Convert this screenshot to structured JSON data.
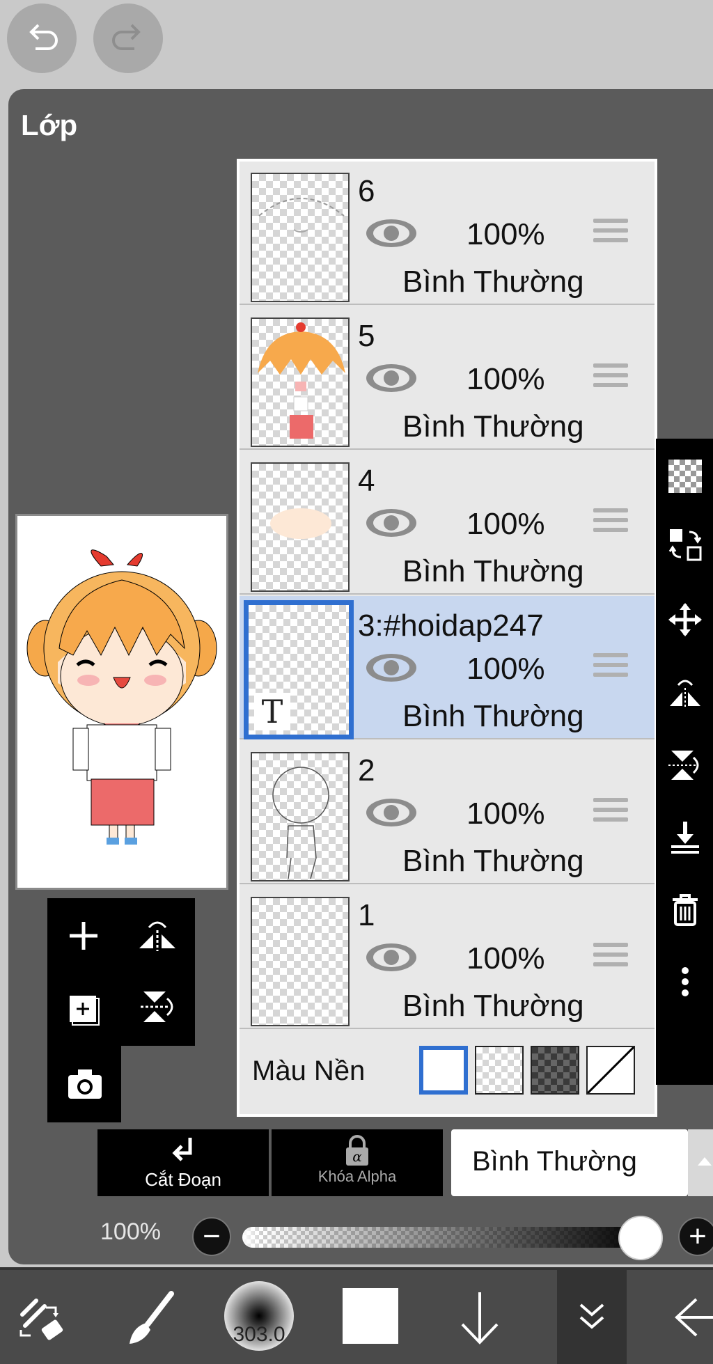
{
  "toolbar_top": {
    "undo": "undo-icon",
    "redo": "redo-icon"
  },
  "panel": {
    "title": "Lớp"
  },
  "layers": [
    {
      "name": "6",
      "opacity": "100%",
      "blend": "Bình Thường",
      "selected": false
    },
    {
      "name": "5",
      "opacity": "100%",
      "blend": "Bình Thường",
      "selected": false
    },
    {
      "name": "4",
      "opacity": "100%",
      "blend": "Bình Thường",
      "selected": false
    },
    {
      "name": "3:#hoidap247",
      "opacity": "100%",
      "blend": "Bình Thường",
      "selected": true,
      "badge": "T"
    },
    {
      "name": "2",
      "opacity": "100%",
      "blend": "Bình Thường",
      "selected": false
    },
    {
      "name": "1",
      "opacity": "100%",
      "blend": "Bình Thường",
      "selected": false
    }
  ],
  "background": {
    "label": "Màu Nền",
    "options": [
      "white",
      "transparent",
      "dark-checker",
      "none"
    ],
    "selected": "white"
  },
  "actions": {
    "clip_label": "Cắt Đoạn",
    "alpha_lock_label": "Khóa Alpha"
  },
  "blend_mode": {
    "value": "Bình Thường"
  },
  "opacity": {
    "label": "100%",
    "value": 1.0
  },
  "bottom": {
    "brush_size": "303.0",
    "color": "#ffffff"
  },
  "colors": {
    "accent": "#2f6fd0",
    "selected_row": "#c8d7ef"
  }
}
